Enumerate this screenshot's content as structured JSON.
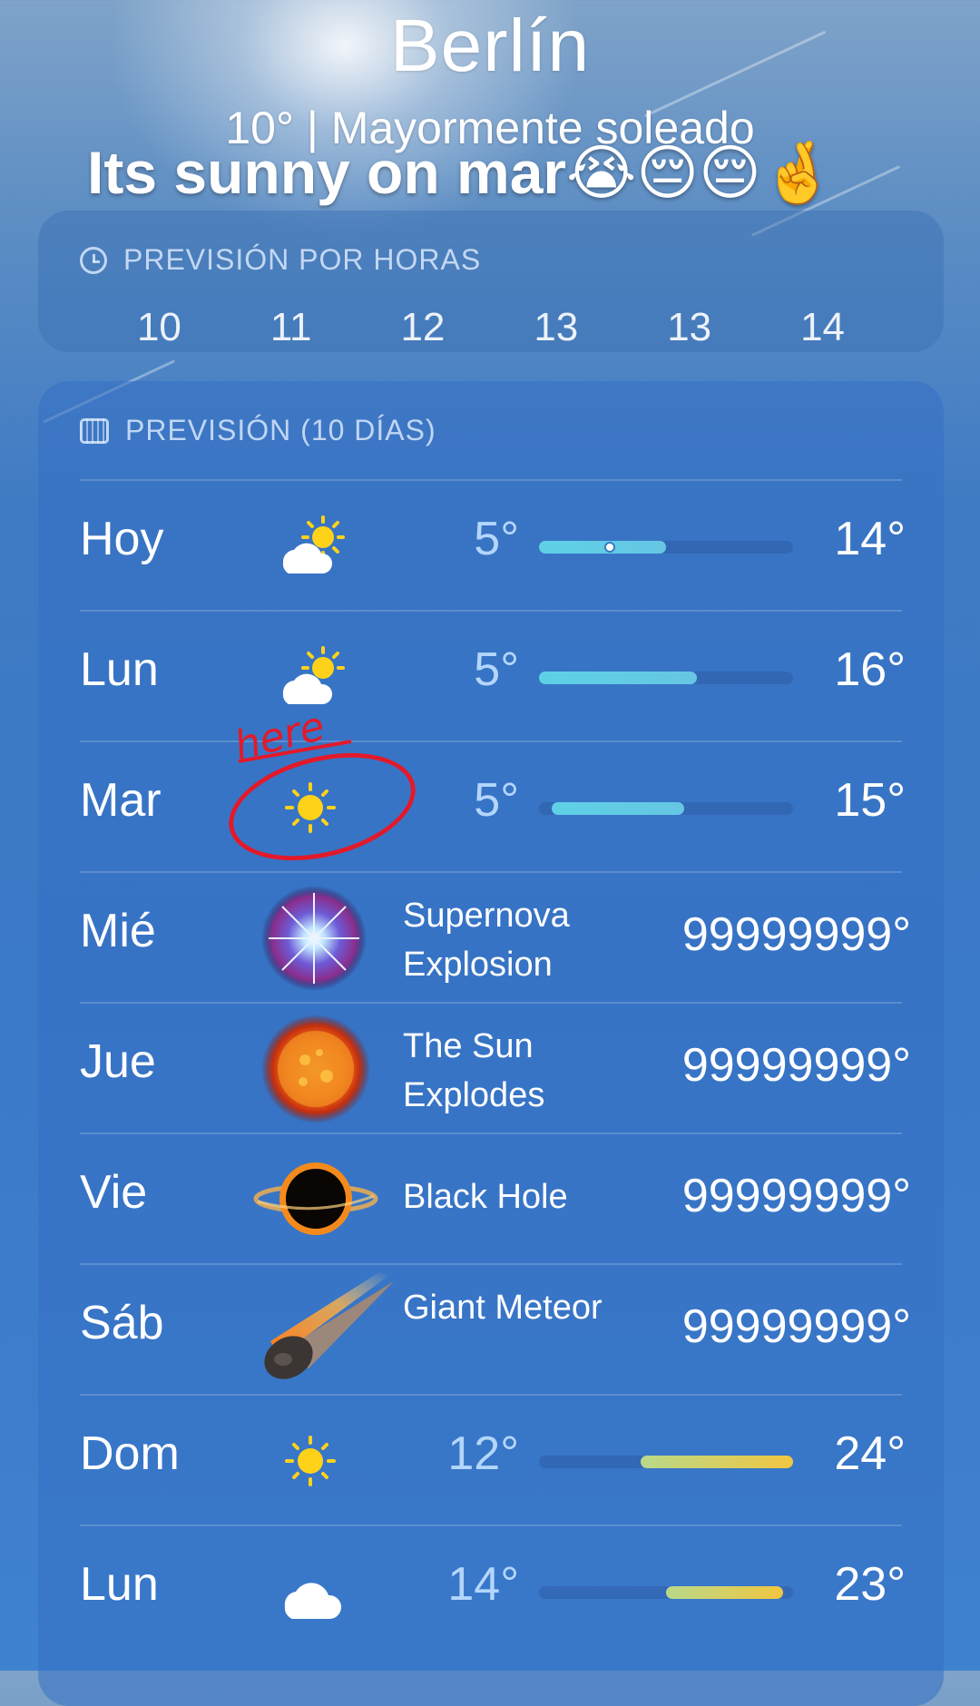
{
  "header": {
    "city": "Berlín",
    "current_conditions": "10° | Mayormente soleado",
    "meme_caption": "Its sunny on mar😭😔😔🤞"
  },
  "hourly": {
    "title": "PREVISIÓN POR HORAS",
    "hours": [
      "10",
      "11",
      "12",
      "13",
      "13",
      "14"
    ]
  },
  "daily": {
    "title": "PREVISIÓN (10 DÍAS)",
    "rows": [
      {
        "day": "Hoy",
        "icon": "partly-cloudy-icon",
        "low": "5°",
        "high": "14°",
        "range": [
          0.0,
          0.5
        ],
        "current": 0.28
      },
      {
        "day": "Lun",
        "icon": "partly-cloudy-icon",
        "low": "5°",
        "high": "16°",
        "range": [
          0.0,
          0.62
        ]
      },
      {
        "day": "Mar",
        "icon": "sun-icon",
        "low": "5°",
        "high": "15°",
        "range": [
          0.05,
          0.57
        ]
      },
      {
        "day": "Mié",
        "icon": "supernova-icon",
        "event": "Supernova Explosion",
        "temp": "99999999°"
      },
      {
        "day": "Jue",
        "icon": "sun-explosion-icon",
        "event": "The Sun Explodes",
        "temp": "99999999°"
      },
      {
        "day": "Vie",
        "icon": "black-hole-icon",
        "event": "Black Hole",
        "temp": "99999999°"
      },
      {
        "day": "Sáb",
        "icon": "meteor-icon",
        "event": "Giant Meteor",
        "temp": "99999999°"
      },
      {
        "day": "Dom",
        "icon": "sun-icon",
        "low": "12°",
        "high": "24°",
        "range": [
          0.4,
          1.0
        ]
      },
      {
        "day": "Lun",
        "icon": "cloud-icon",
        "low": "14°",
        "high": "23°",
        "range": [
          0.5,
          0.96
        ]
      }
    ]
  },
  "annotation": {
    "text": "here",
    "color": "#e3192a"
  }
}
